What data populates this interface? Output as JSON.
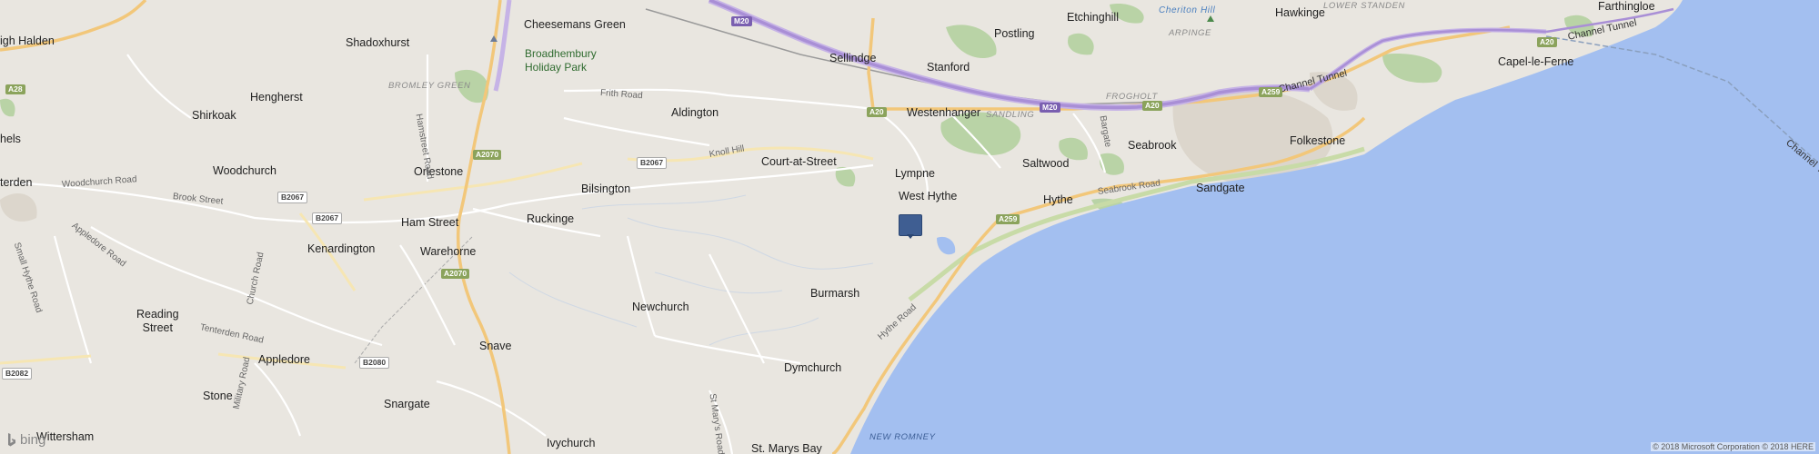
{
  "map": {
    "places": {
      "farthingloe": "Farthingloe",
      "high_halden": "igh Halden",
      "shadoxhurst": "Shadoxhurst",
      "cheesemans_green": "Cheesemans Green",
      "broadhembury": "Broadhembury\nHoliday Park",
      "sellindge": "Sellindge",
      "stanford": "Stanford",
      "postling": "Postling",
      "etchinghill": "Etchinghill",
      "hawkinge": "Hawkinge",
      "capel": "Capel-le-Ferne",
      "hengherst": "Hengherst",
      "shirkoak": "Shirkoak",
      "aldington": "Aldington",
      "westenhanger": "Westenhanger",
      "bethersden": "hels",
      "woodchurch": "Woodchurch",
      "orlestone": "Orlestone",
      "bilsington": "Bilsington",
      "court_at_street": "Court-at-Street",
      "lympne": "Lympne",
      "saltwood": "Saltwood",
      "seabrook": "Seabrook",
      "folkestone": "Folkestone",
      "tenterden": "terden",
      "west_hythe": "West Hythe",
      "sandgate": "Sandgate",
      "hythe": "Hythe",
      "ham_street": "Ham Street",
      "ruckinge": "Ruckinge",
      "kenardington": "Kenardington",
      "warehorne": "Warehorne",
      "burmarsh": "Burmarsh",
      "newchurch": "Newchurch",
      "reading_street": "Reading\nStreet",
      "snave": "Snave",
      "appledore": "Appledore",
      "dymchurch": "Dymchurch",
      "stone": "Stone",
      "snargate": "Snargate",
      "wittersham": "Wittersham",
      "ivychurch": "Ivychurch",
      "st_marys_bay": "St. Marys Bay"
    },
    "districts": {
      "cheriton_hill": "Cheriton Hill",
      "arpinge": "ARPINGE",
      "lower_standen": "LOWER STANDEN",
      "bromley_green": "BROMLEY GREEN",
      "frogholt": "FROGHOLT",
      "sandling": "SANDLING",
      "new_romney": "NEW ROMNEY"
    },
    "roads": {
      "channel_tunnel_1": "Channel Tunnel",
      "channel_tunnel_2": "Channel Tunnel",
      "frith_road": "Frith Road",
      "knoll_hill": "Knoll Hill",
      "hamstreet_road": "Hamstreet Road",
      "woodchurch_road": "Woodchurch Road",
      "brook_street": "Brook Street",
      "appledore_road": "Appledore Road",
      "small_hythe_road": "Small Hythe Road",
      "tenterden_road": "Tenterden Road",
      "bayle": "Bargate",
      "seabrook_road": "Seabrook Road",
      "hythe_road": "Hythe Road",
      "st_marys_road": "St Mary's Road",
      "military_road": "Military Road",
      "church_road": "Church Road"
    },
    "shields": {
      "m20_top": "M20",
      "m20_mid": "M20",
      "a20_a": "A20",
      "a20_b": "A20",
      "a20_c": "A20",
      "a259_a": "A259",
      "a259_b": "A259",
      "a28": "A28",
      "a2070_a": "A2070",
      "a2070_b": "A2070",
      "b2067_a": "B2067",
      "b2067_b": "B2067",
      "b2067_c": "B2067",
      "b2080": "B2080",
      "b2082": "B2082"
    },
    "brand": "bing",
    "copyright": "© 2018 Microsoft Corporation © 2018 HERE",
    "colors": {
      "land": "#e9e6e0",
      "sea": "#a3bff0",
      "motorway": "#a98fd6",
      "a_road": "#f2c77a",
      "park": "#b9d3a6",
      "pin": "#3f5e92"
    }
  }
}
